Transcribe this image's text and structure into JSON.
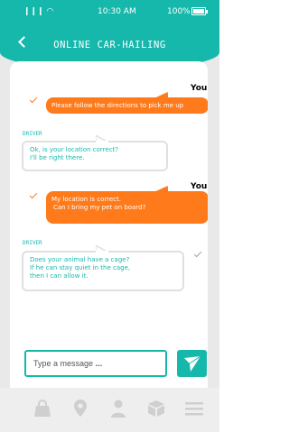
{
  "status_bar": {
    "signal": "❙❙❙ ◠",
    "time": "10:30 AM",
    "battery": "100%"
  },
  "header": {
    "title": "ONLINE CAR-HAILING",
    "back_icon": "chevron-left-icon"
  },
  "messages": [
    {
      "sender": "You",
      "text": "Please follow the directions to pick me up",
      "status_icon": "check-icon"
    },
    {
      "sender": "DRIVER",
      "text_lines": [
        "Ok, is your location correct?",
        "I'll be right there."
      ]
    },
    {
      "sender": "You",
      "text_lines": [
        "My location is correct.",
        "Can I bring my pet on board?"
      ],
      "status_icon": "check-icon"
    },
    {
      "sender": "DRIVER",
      "text_lines": [
        "Does your animal have a cage?",
        "If he can stay quiet in the cage,",
        "then I can allow it."
      ],
      "status_icon": "check-icon"
    }
  ],
  "composer": {
    "placeholder": "Type a message",
    "ellipsis": "...",
    "send_icon": "paper-plane-icon"
  },
  "tabbar": {
    "items": [
      "bag-icon",
      "location-pin-icon",
      "user-icon",
      "box-icon",
      "menu-icon"
    ]
  },
  "colors": {
    "accent": "#17b8ac",
    "orange": "#ff7a1a"
  }
}
